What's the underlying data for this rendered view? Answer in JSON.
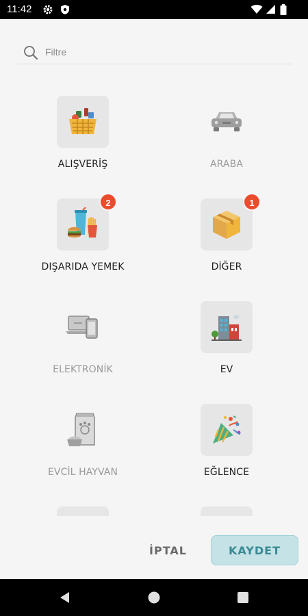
{
  "status_bar": {
    "time": "11:42",
    "icons": [
      "gear-icon",
      "shield-icon",
      "wifi-icon",
      "signal-icon",
      "battery-icon"
    ]
  },
  "search": {
    "placeholder": "Filtre",
    "value": "",
    "icon": "search-icon"
  },
  "categories": [
    {
      "label": "ALIŞVERİŞ",
      "badge": "",
      "enabled": true,
      "icon": "shopping-basket-icon"
    },
    {
      "label": "ARABA",
      "badge": "",
      "enabled": false,
      "icon": "car-icon"
    },
    {
      "label": "DIŞARIDA YEMEK",
      "badge": "2",
      "enabled": true,
      "icon": "fast-food-icon"
    },
    {
      "label": "DİĞER",
      "badge": "1",
      "enabled": true,
      "icon": "box-icon"
    },
    {
      "label": "ELEKTRONİK",
      "badge": "",
      "enabled": false,
      "icon": "devices-icon"
    },
    {
      "label": "EV",
      "badge": "",
      "enabled": true,
      "icon": "building-icon"
    },
    {
      "label": "EVCİL HAYVAN",
      "badge": "",
      "enabled": false,
      "icon": "pet-food-icon"
    },
    {
      "label": "EĞLENCE",
      "badge": "",
      "enabled": true,
      "icon": "party-popper-icon"
    }
  ],
  "actions": {
    "cancel_label": "İPTAL",
    "save_label": "KAYDET"
  },
  "colors": {
    "badge": "#ea4d2e",
    "save_button_bg": "#c5e3e6",
    "save_button_text": "#3a8a94",
    "background": "#f5f5f5"
  },
  "nav_bar": {
    "icons": [
      "back-icon",
      "home-icon",
      "recents-icon"
    ]
  }
}
